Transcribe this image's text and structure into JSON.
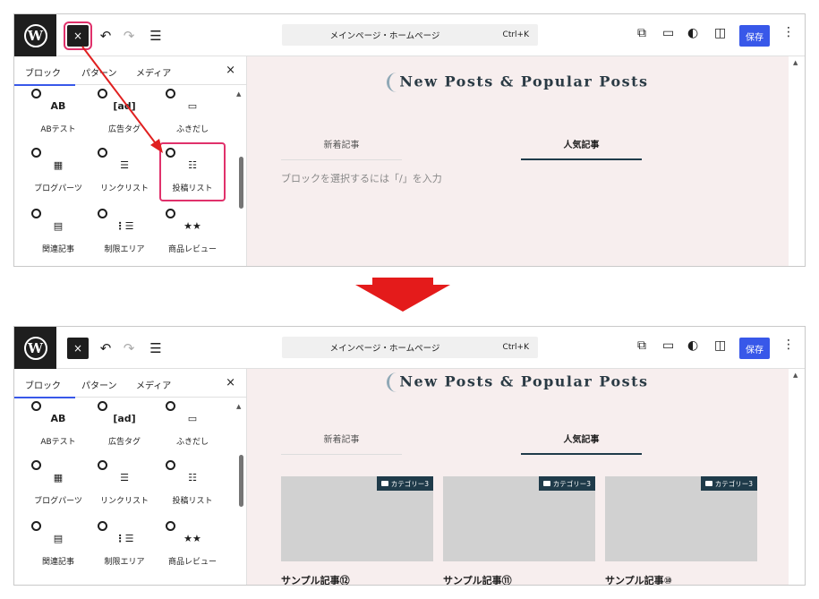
{
  "toolbar": {
    "logo": "W",
    "close": "×",
    "undo": "↶",
    "redo": "↷",
    "list": "☰",
    "document_title": "メインページ・ホームページ",
    "shortcut": "Ctrl+K",
    "save": "保存",
    "more": "⋮"
  },
  "inserter": {
    "tabs": [
      "ブロック",
      "パターン",
      "メディア"
    ],
    "close": "×",
    "blocks": [
      {
        "label": "ABテスト",
        "glyph": "AB",
        "icon": "ab-test-icon"
      },
      {
        "label": "広告タグ",
        "glyph": "[ad]",
        "icon": "ad-tag-icon"
      },
      {
        "label": "ふきだし",
        "glyph": "▭",
        "icon": "speech-balloon-icon"
      },
      {
        "label": "ブログパーツ",
        "glyph": "▦",
        "icon": "blog-parts-icon"
      },
      {
        "label": "リンクリスト",
        "glyph": "☰",
        "icon": "link-list-icon"
      },
      {
        "label": "投稿リスト",
        "glyph": "☷",
        "icon": "post-list-icon"
      },
      {
        "label": "関連記事",
        "glyph": "▤",
        "icon": "related-posts-icon"
      },
      {
        "label": "制限エリア",
        "glyph": "⋮☰",
        "icon": "restricted-area-icon"
      },
      {
        "label": "商品レビュー",
        "glyph": "★★",
        "icon": "product-review-icon"
      }
    ]
  },
  "canvas": {
    "site_title": "New Posts & Popular Posts",
    "post_tabs": [
      "新着記事",
      "人気記事"
    ],
    "placeholder": "ブロックを選択するには「/」を入力",
    "cards": [
      {
        "category": "カテゴリー3",
        "title": "サンプル記事⑫"
      },
      {
        "category": "カテゴリー3",
        "title": "サンプル記事⑪"
      },
      {
        "category": "カテゴリー3",
        "title": "サンプル記事⑩"
      }
    ]
  },
  "colors": {
    "annotation": "#e0316b",
    "arrow": "#e02020",
    "accent": "#3858e9",
    "canvas_bg": "#f7eeee",
    "badge_bg": "#1f3b4a"
  }
}
